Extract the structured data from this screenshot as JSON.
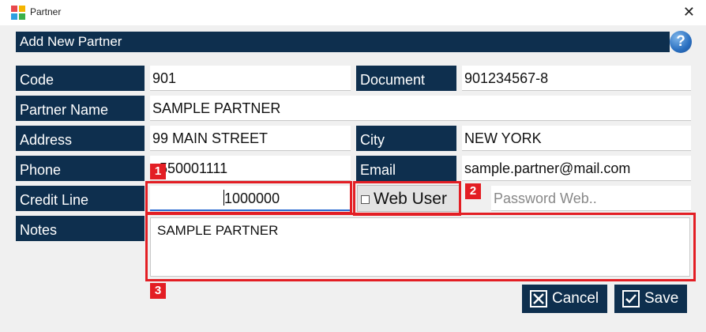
{
  "window": {
    "title": "Partner",
    "close_glyph": "✕"
  },
  "header": {
    "title": "Add New Partner",
    "help_glyph": "?"
  },
  "form": {
    "code": {
      "label": "Code",
      "value": "901"
    },
    "document": {
      "label": "Document",
      "value": "901234567-8"
    },
    "partner_name": {
      "label": "Partner Name",
      "value": "SAMPLE PARTNER"
    },
    "address": {
      "label": "Address",
      "value": "99 MAIN STREET"
    },
    "city": {
      "label": "City",
      "value": "NEW YORK"
    },
    "phone": {
      "label": "Phone",
      "value": "550001111"
    },
    "email": {
      "label": "Email",
      "value": "sample.partner@mail.com"
    },
    "credit_line": {
      "label": "Credit Line",
      "value": "1000000"
    },
    "web_user": {
      "label": "Web User",
      "checked": false
    },
    "password_web": {
      "placeholder": "Password Web.."
    },
    "notes": {
      "label": "Notes",
      "value": "SAMPLE PARTNER"
    }
  },
  "buttons": {
    "cancel_label": "Cancel",
    "save_label": "Save"
  },
  "markers": [
    "1",
    "2",
    "3"
  ],
  "colors": {
    "label_bg": "#0e2f4e",
    "marker_red": "#e31e24",
    "focus_blue": "#2b6ad0"
  },
  "icons": {
    "app": "app-logo-icon",
    "help": "help-icon",
    "cancel": "close-box-icon",
    "save": "check-box-icon"
  }
}
